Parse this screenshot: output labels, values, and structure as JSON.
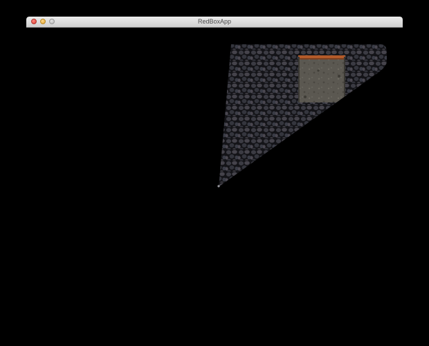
{
  "window": {
    "title": "RedBoxApp"
  },
  "icons": {
    "close": "close-icon",
    "minimize": "minimize-icon",
    "zoom": "zoom-icon"
  },
  "colors": {
    "background": "#000000",
    "floor_stone": "#3a3a40",
    "block_stone": "#5a574f",
    "block_edge": "#b35b2a"
  }
}
